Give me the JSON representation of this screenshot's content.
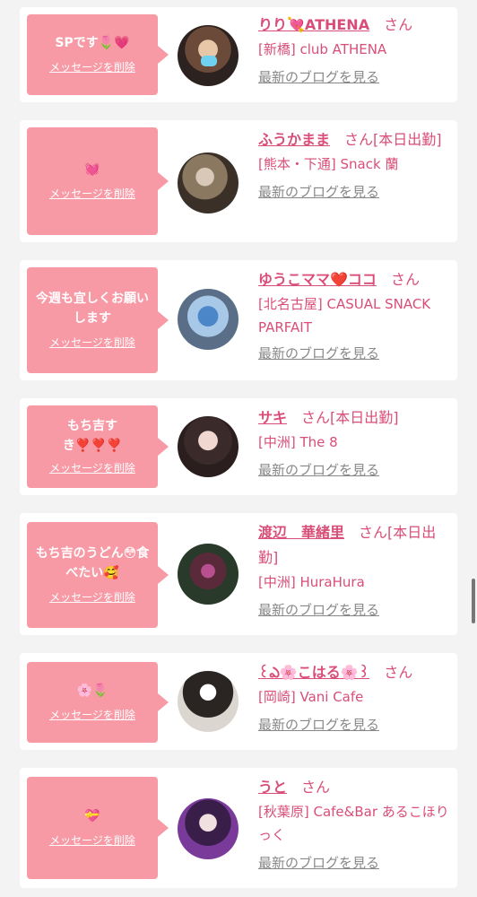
{
  "accent": "#d94e78",
  "bubble_color": "#f89aa6",
  "delete_label": "メッセージを削除",
  "blog_label": "最新のブログを見る",
  "san": "さん",
  "cards": [
    {
      "message": "SPです🌷💗",
      "name": "りり💘ATHENA",
      "suffix": "",
      "shop": "[新橋] club ATHENA"
    },
    {
      "message": "💓",
      "name": "ふうかまま",
      "suffix": "[本日出勤]",
      "shop": "[熊本・下通] Snack 蘭"
    },
    {
      "message": "今週も宜しくお願いします",
      "name": "ゆうこママ❤️ココ",
      "suffix": "",
      "shop": "[北名古屋] CASUAL SNACK PARFAIT"
    },
    {
      "message": "もち吉すき❣️❣️❣️",
      "name": "サキ",
      "suffix": "[本日出勤]",
      "shop": "[中洲] The 8"
    },
    {
      "message": "もち吉のうどん😳食べたい🥰",
      "name": "渡辺　華緒里",
      "suffix": "[本日出勤]",
      "shop": "[中洲] HuraHura"
    },
    {
      "message": "🌸🌷",
      "name": "꒰ఎ🌸こはる🌸꒱",
      "suffix": "",
      "shop": "[岡崎] Vani Cafe"
    },
    {
      "message": "💝",
      "name": "うと",
      "suffix": "",
      "shop": "[秋葉原] Cafe&Bar あるこほりっく"
    }
  ]
}
